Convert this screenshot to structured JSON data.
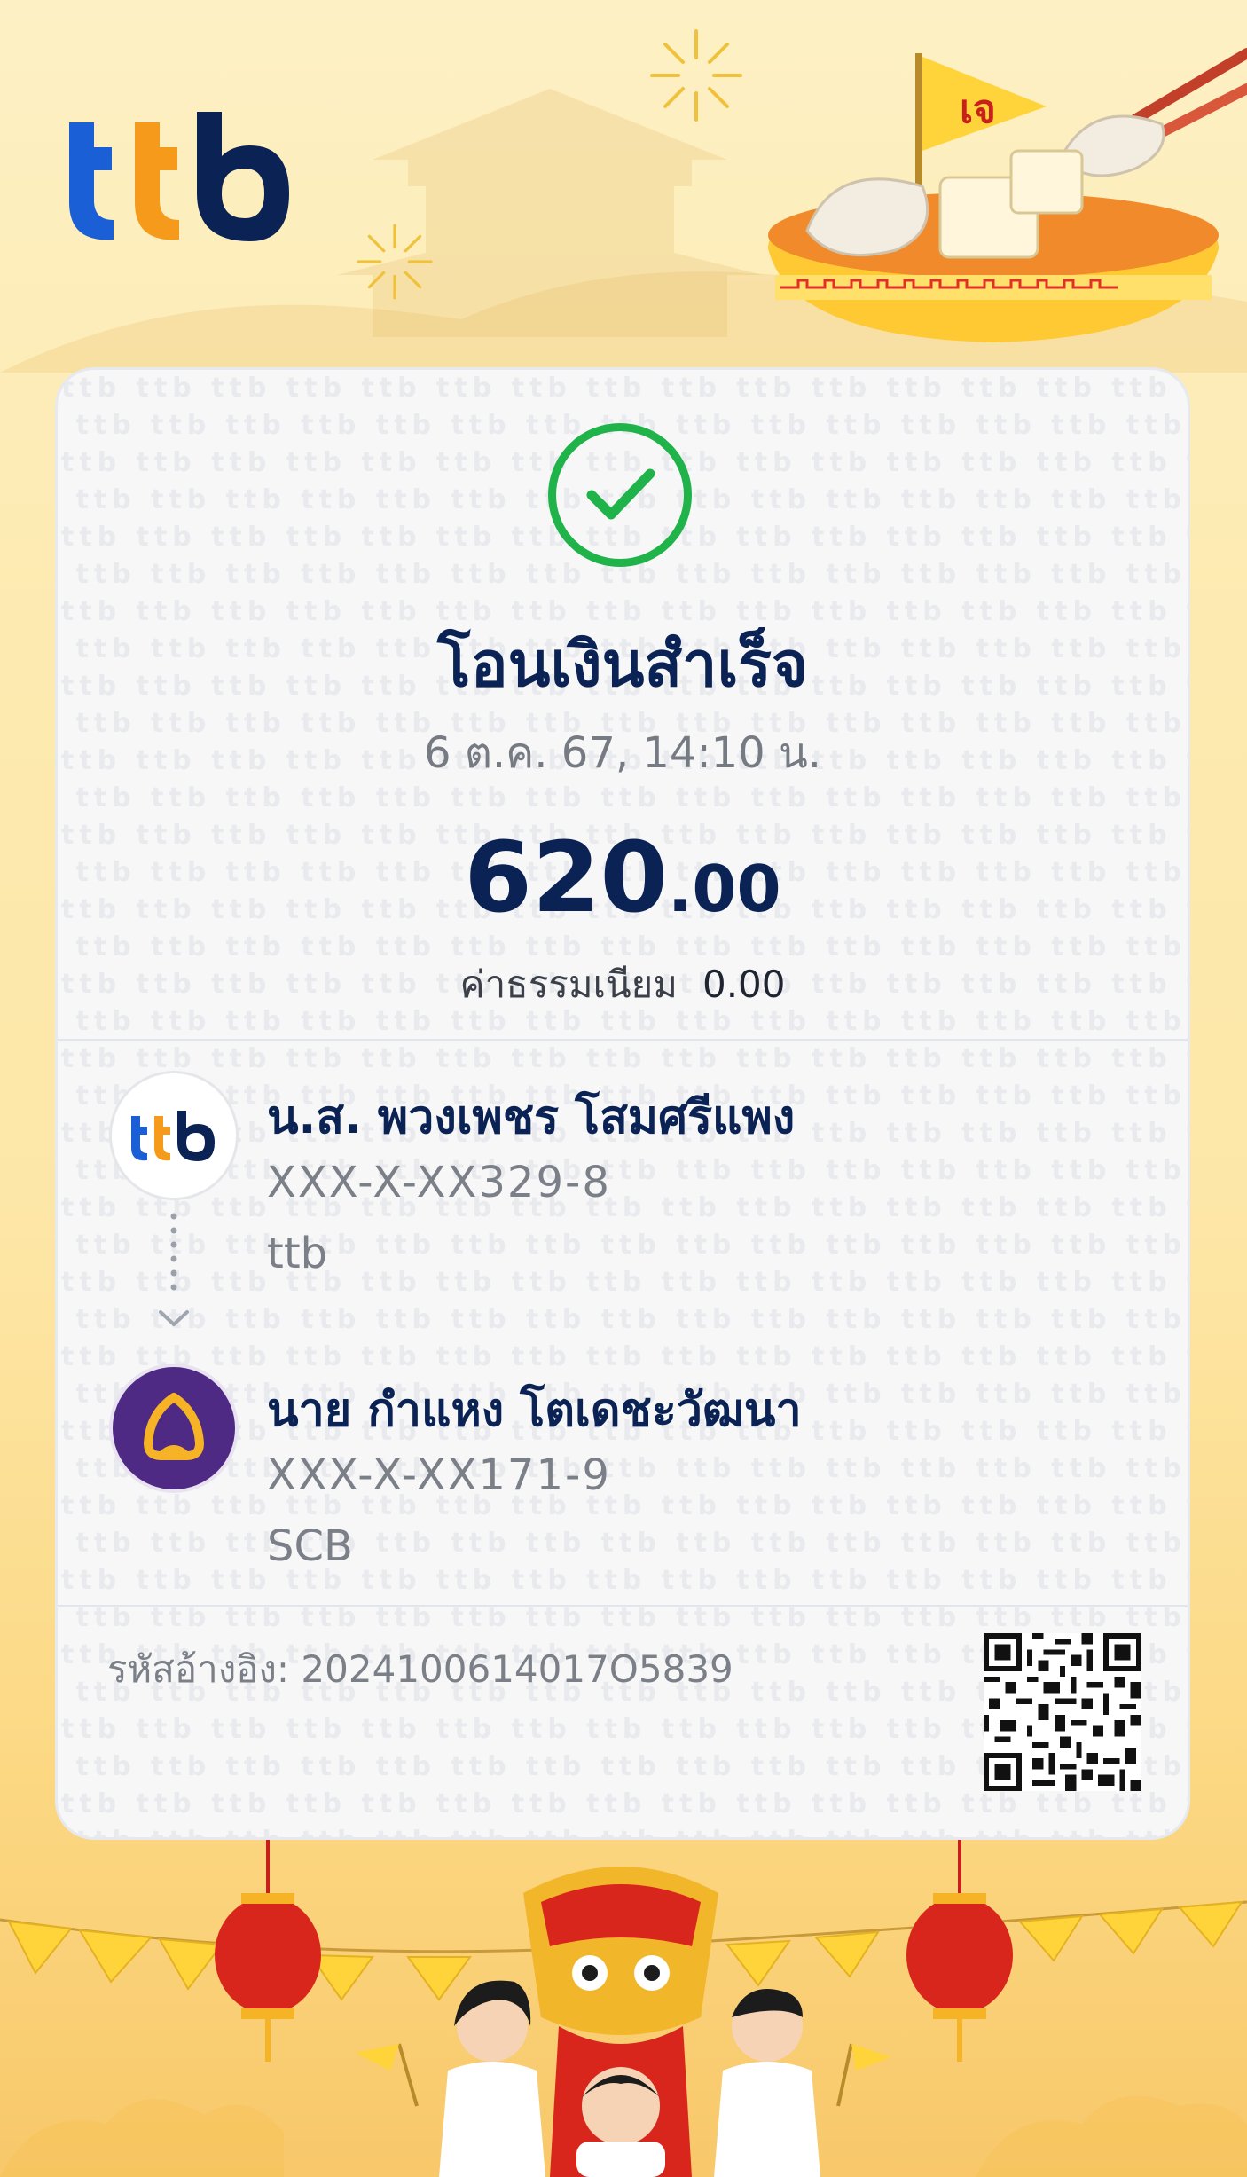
{
  "brand": {
    "logo_text": "ttb"
  },
  "status": {
    "title": "โอนเงินสำเร็จ",
    "datetime": "6 ต.ค. 67, 14:10 น."
  },
  "amount": {
    "main": "620",
    "decimal": ".00"
  },
  "fee": {
    "label": "ค่าธรรมเนียม",
    "value": "0.00"
  },
  "sender": {
    "name": "น.ส. พวงเพชร โสมศรีแพง",
    "account": "XXX-X-XX329-8",
    "bank": "ttb"
  },
  "receiver": {
    "name": "นาย กำแหง โตเดชะวัฒนา",
    "account": "XXX-X-XX171-9",
    "bank": "SCB"
  },
  "reference": {
    "text": "รหัสอ้างอิง: 2024100614017O5839"
  },
  "decor": {
    "flag_text": "เจ"
  },
  "colors": {
    "brand_navy": "#0a2254",
    "brand_blue": "#1b5fd6",
    "brand_orange": "#f59a1b",
    "success_green": "#1fb34a",
    "scb_purple": "#4e2a84"
  },
  "icons": [
    "ttb-logo",
    "success-check-icon",
    "ttb-bank-icon",
    "scb-bank-icon",
    "arrow-down-icon",
    "qr-code"
  ]
}
